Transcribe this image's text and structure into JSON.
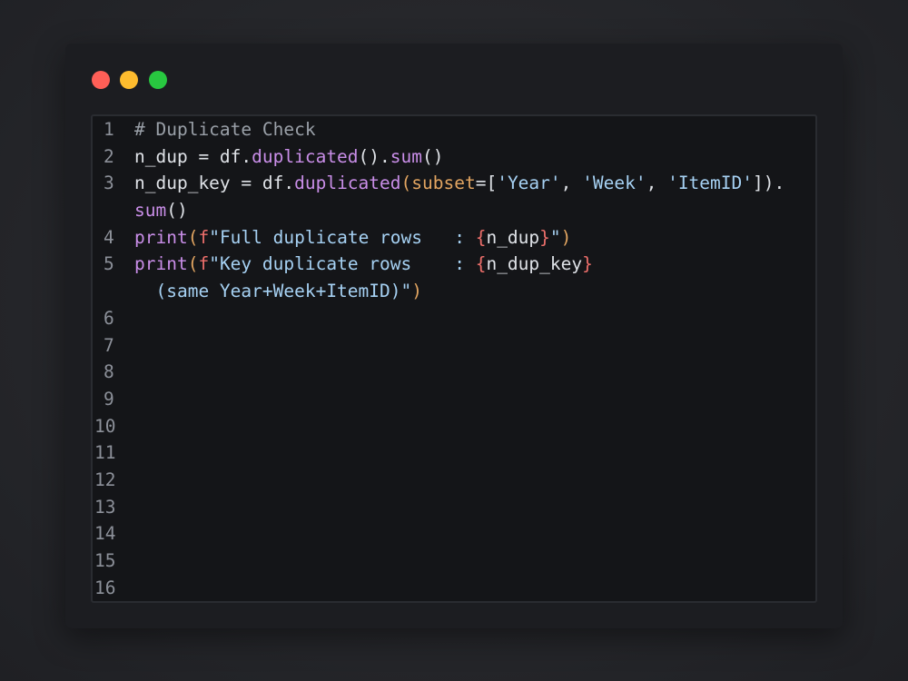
{
  "window": {
    "controls": [
      {
        "name": "close",
        "color": "#ff5f57"
      },
      {
        "name": "minimize",
        "color": "#febc2e"
      },
      {
        "name": "maximize",
        "color": "#28c840"
      }
    ]
  },
  "colors": {
    "comment": "#9aa0a8",
    "plain": "#dfe2e7",
    "function": "#c98ee8",
    "parameter": "#e2a561",
    "string": "#a6d1f3",
    "fstring_prefix_and_braces": "#ee6f6b",
    "line_number": "#8c9099"
  },
  "editor": {
    "line_numbers": [
      "1",
      "2",
      "3",
      "",
      "4",
      "5",
      "",
      "6",
      "7",
      "8",
      "9",
      "10",
      "11",
      "12",
      "13",
      "14",
      "15",
      "16"
    ],
    "code": {
      "l1": {
        "comment": "# Duplicate Check"
      },
      "l2": {
        "a": "n_dup = df.",
        "b": "duplicated",
        "c": "().",
        "d": "sum",
        "e": "()"
      },
      "l3": {
        "a": "n_dup_key = df.",
        "b": "duplicated",
        "c": "(",
        "d": "subset",
        "e": "=[",
        "f": "'Year'",
        "g": ", ",
        "h": "'Week'",
        "i": ", ",
        "j": "'ItemID'",
        "k": "])."
      },
      "l3b": {
        "a": "sum",
        "b": "()"
      },
      "l4": {
        "a": "print",
        "b": "(",
        "c": "f",
        "d": "\"Full duplicate rows   : ",
        "e": "{",
        "f": "n_dup",
        "g": "}",
        "h": "\"",
        "i": ")"
      },
      "l5": {
        "a": "print",
        "b": "(",
        "c": "f",
        "d": "\"Key duplicate rows    : ",
        "e": "{",
        "f": "n_dup_key",
        "g": "}"
      },
      "l5b": {
        "a": "  (same Year+Week+ItemID)\"",
        "b": ")"
      }
    }
  }
}
